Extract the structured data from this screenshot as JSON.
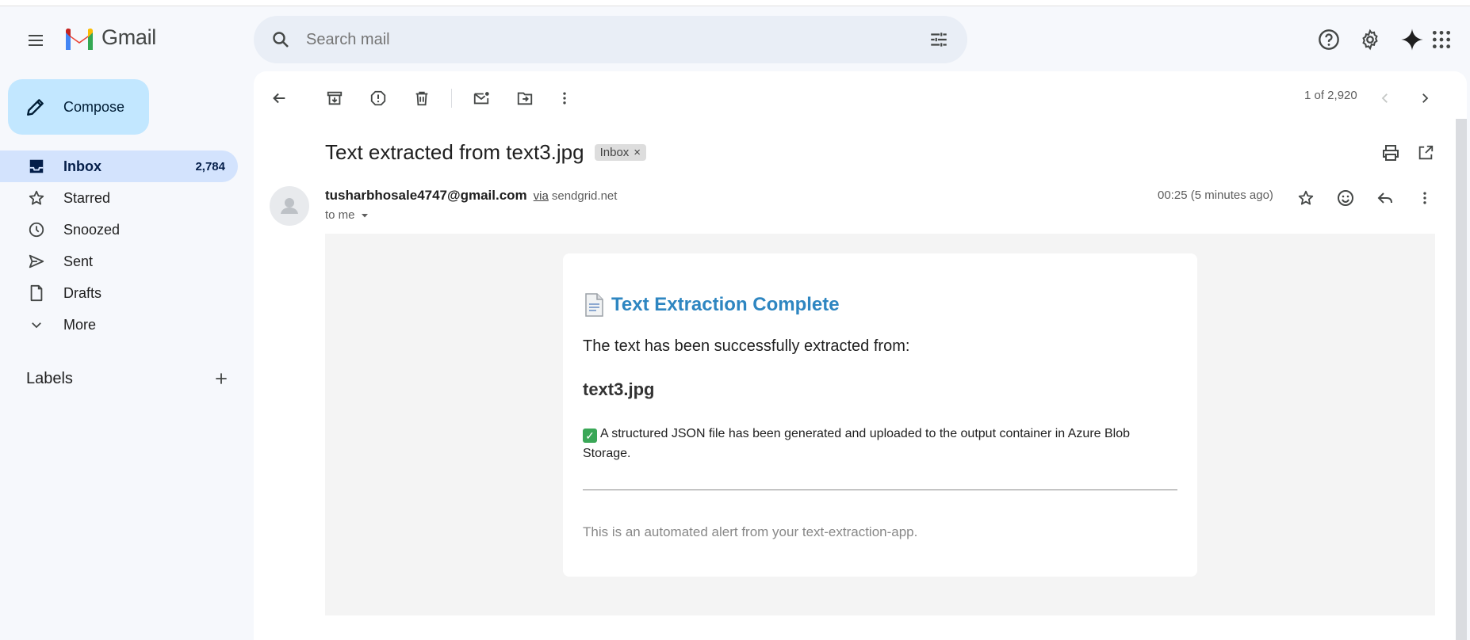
{
  "app": {
    "name": "Gmail"
  },
  "search": {
    "placeholder": "Search mail"
  },
  "sidebar": {
    "compose_label": "Compose",
    "items": [
      {
        "label": "Inbox",
        "count": "2,784",
        "icon": "inbox-icon",
        "active": true
      },
      {
        "label": "Starred",
        "icon": "star-icon"
      },
      {
        "label": "Snoozed",
        "icon": "clock-icon"
      },
      {
        "label": "Sent",
        "icon": "send-icon"
      },
      {
        "label": "Drafts",
        "icon": "draft-icon"
      },
      {
        "label": "More",
        "icon": "chevron-down-icon"
      }
    ],
    "labels_title": "Labels"
  },
  "toolbar": {
    "pager": "1 of 2,920"
  },
  "message": {
    "subject": "Text extracted from text3.jpg",
    "tag": "Inbox",
    "tag_close": "×",
    "sender_email": "tusharbhosale4747@gmail.com",
    "via": "via",
    "via_domain": "sendgrid.net",
    "to": "to me",
    "time": "00:25 (5 minutes ago)"
  },
  "email_body": {
    "title": "Text Extraction Complete",
    "intro": "The text has been successfully extracted from:",
    "filename": "text3.jpg",
    "status": "A structured JSON file has been generated and uploaded to the output container in Azure Blob Storage.",
    "footer": "This is an automated alert from your text-extraction-app."
  },
  "colors": {
    "accent": "#2e86c1",
    "compose_bg": "#c2e7ff",
    "active_nav": "#d3e3fd",
    "search_bg": "#e9eef6"
  }
}
